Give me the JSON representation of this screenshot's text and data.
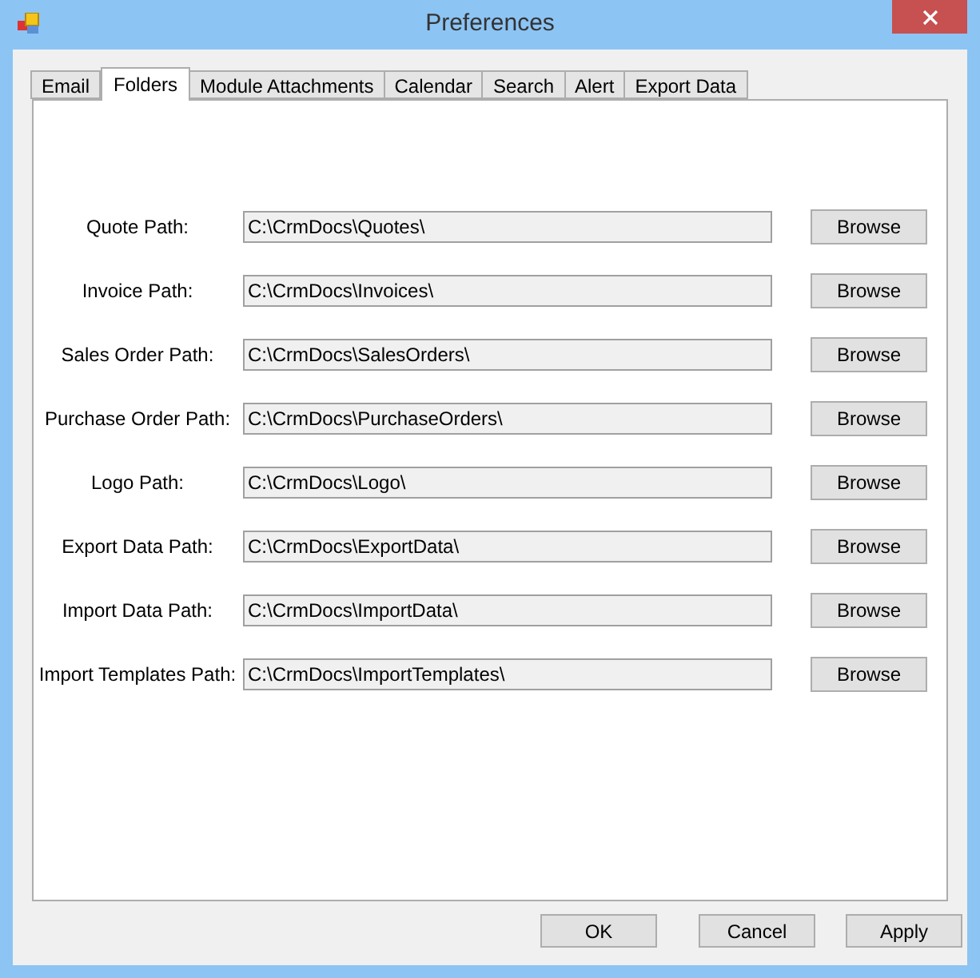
{
  "window": {
    "title": "Preferences"
  },
  "tabs": [
    {
      "label": "Email",
      "selected": false
    },
    {
      "label": "Folders",
      "selected": true
    },
    {
      "label": "Module Attachments",
      "selected": false
    },
    {
      "label": "Calendar",
      "selected": false
    },
    {
      "label": "Search",
      "selected": false
    },
    {
      "label": "Alert",
      "selected": false
    },
    {
      "label": "Export Data",
      "selected": false
    }
  ],
  "paths": [
    {
      "label": "Quote Path:",
      "value": "C:\\CrmDocs\\Quotes\\",
      "button": "Browse"
    },
    {
      "label": "Invoice Path:",
      "value": "C:\\CrmDocs\\Invoices\\",
      "button": "Browse"
    },
    {
      "label": "Sales Order Path:",
      "value": "C:\\CrmDocs\\SalesOrders\\",
      "button": "Browse"
    },
    {
      "label": "Purchase Order Path:",
      "value": "C:\\CrmDocs\\PurchaseOrders\\",
      "button": "Browse"
    },
    {
      "label": "Logo Path:",
      "value": "C:\\CrmDocs\\Logo\\",
      "button": "Browse"
    },
    {
      "label": "Export Data Path:",
      "value": "C:\\CrmDocs\\ExportData\\",
      "button": "Browse"
    },
    {
      "label": "Import Data Path:",
      "value": "C:\\CrmDocs\\ImportData\\",
      "button": "Browse"
    },
    {
      "label": "Import Templates Path:",
      "value": "C:\\CrmDocs\\ImportTemplates\\",
      "button": "Browse"
    }
  ],
  "buttons": [
    "OK",
    "Cancel",
    "Apply"
  ]
}
